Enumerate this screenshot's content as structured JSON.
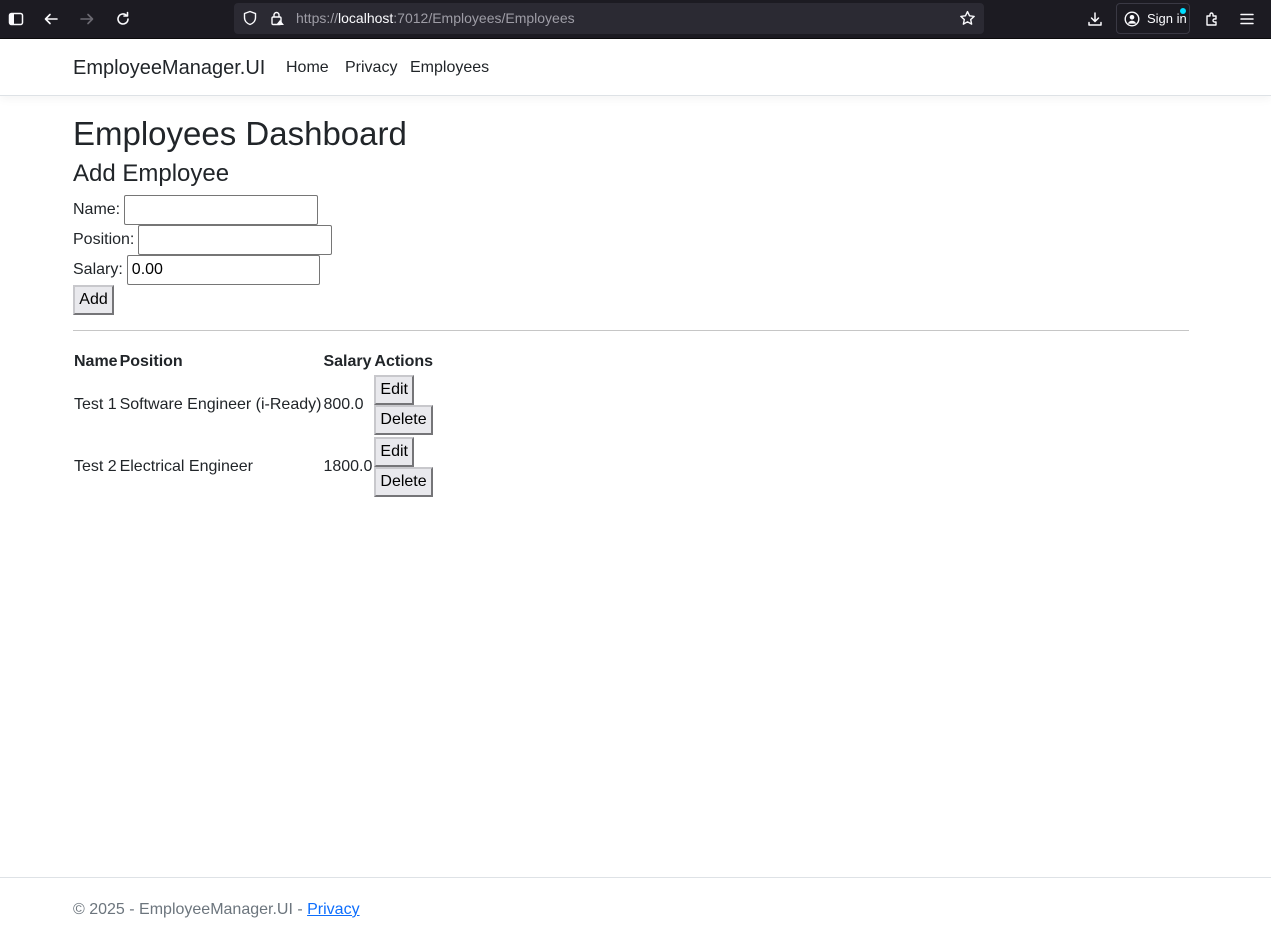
{
  "browser": {
    "url_scheme": "https://",
    "url_host": "localhost",
    "url_rest": ":7012/Employees/Employees",
    "sign_in_label": "Sign in"
  },
  "nav": {
    "brand": "EmployeeManager.UI",
    "links": [
      "Home",
      "Privacy",
      "Employees"
    ]
  },
  "page": {
    "title": "Employees Dashboard",
    "form_heading": "Add Employee",
    "fields": {
      "name": {
        "label": "Name:",
        "value": ""
      },
      "position": {
        "label": "Position:",
        "value": ""
      },
      "salary": {
        "label": "Salary:",
        "value": "0.00"
      }
    },
    "add_label": "Add"
  },
  "table": {
    "headers": [
      "Name",
      "Position",
      "Salary",
      "Actions"
    ],
    "rows": [
      {
        "name": "Test 1",
        "position": "Software Engineer (i-Ready)",
        "salary": "800.0",
        "edit": "Edit",
        "delete": "Delete"
      },
      {
        "name": "Test 2",
        "position": "Electrical Engineer",
        "salary": "1800.0",
        "edit": "Edit",
        "delete": "Delete"
      }
    ]
  },
  "footer": {
    "text": "© 2025 - EmployeeManager.UI - ",
    "link": "Privacy"
  },
  "colors": {
    "chrome_bg": "#1c1b22",
    "urlbar_bg": "#2b2a33",
    "link": "#0d6efd",
    "button_bg": "#e9e9ed"
  },
  "icons": [
    "sidebar-icon",
    "back-arrow-icon",
    "forward-arrow-icon",
    "reload-icon",
    "shield-icon",
    "lock-icon",
    "star-icon",
    "download-icon",
    "account-icon",
    "extensions-icon",
    "menu-icon"
  ]
}
